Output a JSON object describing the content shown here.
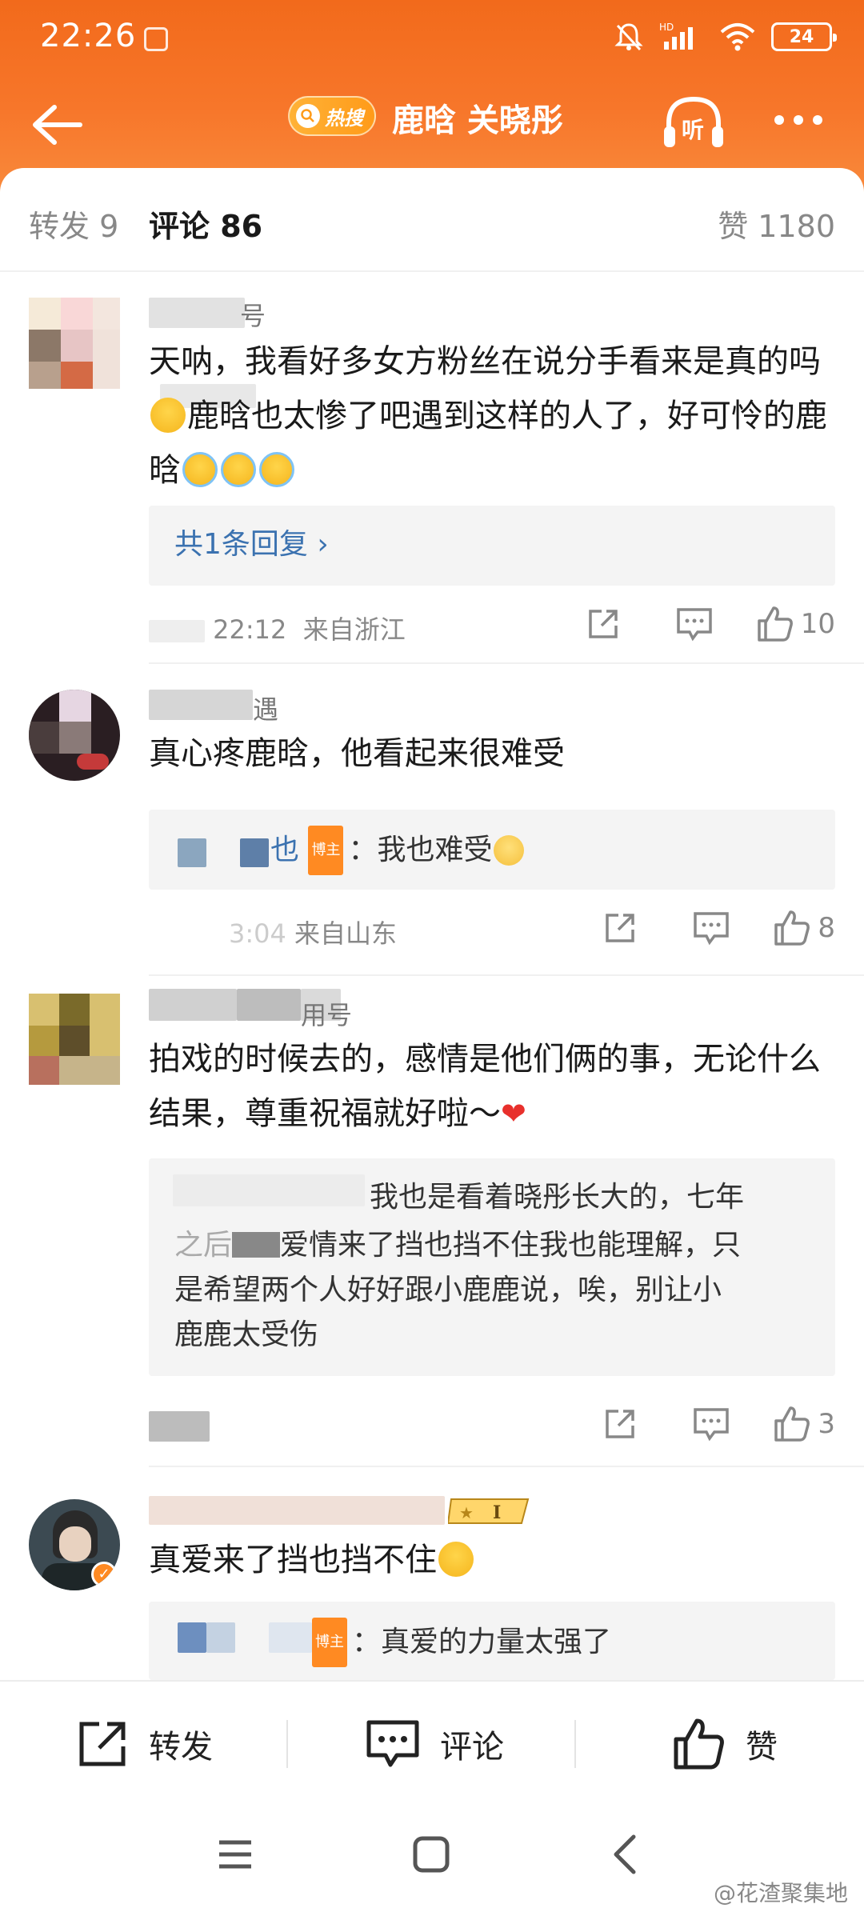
{
  "status": {
    "time": "22:26",
    "battery": "24",
    "hd": "HD"
  },
  "nav": {
    "hot_label": "热搜",
    "title": "鹿晗 关晓彤",
    "listen_label": "听"
  },
  "tabs": {
    "repost": "转发 9",
    "comment": "评论 86",
    "likes": "赞 1180"
  },
  "comments": [
    {
      "username_suffix": "号",
      "text_before_emoji": "天呐，我看好多女方粉丝在说分手看来是真的吗",
      "text_after_emoji": "鹿晗也太惨了吧遇到这样的人了，好可怜的鹿晗",
      "reply_link": "共1条回复 ›",
      "time": "22:12",
      "location": "来自浙江",
      "likes": "10"
    },
    {
      "username_suffix": "遇",
      "text": "真心疼鹿晗，他看起来很难受",
      "reply_name_part": "也",
      "reply_badge": "博主",
      "reply_text": "：我也难受",
      "time_partial": "3:04",
      "location": "来自山东",
      "likes": "8"
    },
    {
      "username_suffix": "用号",
      "text": "拍戏的时候去的，感情是他们俩的事，无论什么结果，尊重祝福就好啦～",
      "reply_line1": "我也是看着晓彤长大的，七年",
      "reply_line2_a": "之后",
      "reply_line2_b": "爱情来了挡也挡不住我也能理解，只",
      "reply_line3": "是希望两个人好好跟小鹿鹿说，唉，别让小",
      "reply_line4": "鹿鹿太受伤",
      "likes": "3"
    },
    {
      "text": "真爱来了挡也挡不住",
      "vip_label": "I",
      "reply_badge": "博主",
      "reply_text": "：真爱的力量太强了"
    }
  ],
  "bottom": {
    "repost": "转发",
    "comment": "评论",
    "like": "赞"
  },
  "watermark": "@花渣聚集地"
}
